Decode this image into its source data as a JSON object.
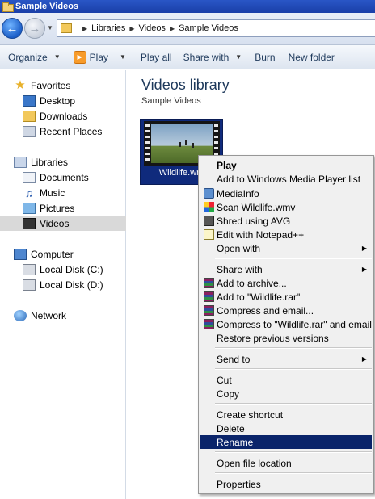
{
  "window": {
    "title": "Sample Videos"
  },
  "address": {
    "segments": [
      "Libraries",
      "Videos",
      "Sample Videos"
    ]
  },
  "toolbar": {
    "organize": "Organize",
    "play": "Play",
    "play_all": "Play all",
    "share_with": "Share with",
    "burn": "Burn",
    "new_folder": "New folder"
  },
  "nav": {
    "favorites": "Favorites",
    "desktop": "Desktop",
    "downloads": "Downloads",
    "recent_places": "Recent Places",
    "libraries": "Libraries",
    "documents": "Documents",
    "music": "Music",
    "pictures": "Pictures",
    "videos": "Videos",
    "computer": "Computer",
    "local_c": "Local Disk (C:)",
    "local_d": "Local Disk (D:)",
    "network": "Network"
  },
  "content": {
    "title": "Videos library",
    "subtitle": "Sample Videos",
    "file_name": "Wildlife.wmv",
    "file_label_visible": "Wildlife.wm"
  },
  "context_menu": {
    "play": "Play",
    "add_wmp": "Add to Windows Media Player list",
    "mediainfo": "MediaInfo",
    "scan": "Scan Wildlife.wmv",
    "shred": "Shred using AVG",
    "notepad": "Edit with Notepad++",
    "open_with": "Open with",
    "share_with": "Share with",
    "add_archive": "Add to archive...",
    "add_rar": "Add to \"Wildlife.rar\"",
    "compress_email": "Compress and email...",
    "compress_rar_email": "Compress to \"Wildlife.rar\" and email",
    "restore": "Restore previous versions",
    "send_to": "Send to",
    "cut": "Cut",
    "copy": "Copy",
    "create_shortcut": "Create shortcut",
    "delete": "Delete",
    "rename": "Rename",
    "open_location": "Open file location",
    "properties": "Properties"
  },
  "colors": {
    "menu_highlight": "#0a246a",
    "title_bar": "#2a56c6",
    "selected_nav": "#d9d9d9"
  }
}
